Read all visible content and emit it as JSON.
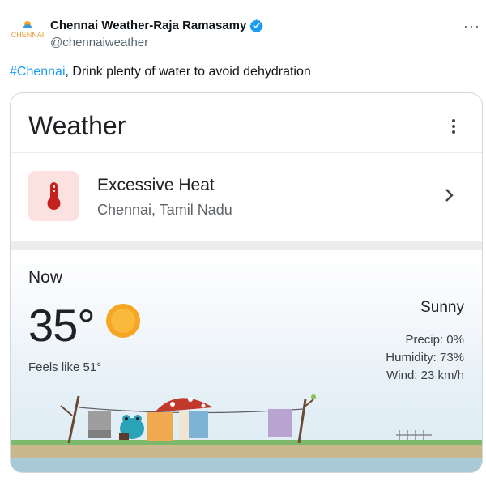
{
  "tweet": {
    "author_name": "Chennai Weather-Raja Ramasamy",
    "handle": "@chennaiweather",
    "avatar_text": "CHENNAI",
    "more_label": "···",
    "hashtag": "#Chennai",
    "body": ", Drink plenty of water to avoid dehydration"
  },
  "card": {
    "title": "Weather",
    "alert": {
      "title": "Excessive Heat",
      "location": "Chennai, Tamil Nadu"
    },
    "now": {
      "label": "Now",
      "temperature": "35°",
      "feels_like": "Feels like 51°",
      "condition": "Sunny",
      "precip": "Precip: 0%",
      "humidity": "Humidity: 73%",
      "wind": "Wind: 23 km/h"
    }
  },
  "colors": {
    "hashtag": "#1d9bf0",
    "verified": "#1d9bf0",
    "alert_bg": "#fbe1df",
    "alert_icon": "#c5221f",
    "sun": "#f6a623"
  },
  "icons": [
    "verified-badge-icon",
    "more-icon",
    "kebab-menu-icon",
    "thermometer-icon",
    "chevron-right-icon",
    "sun-icon"
  ]
}
